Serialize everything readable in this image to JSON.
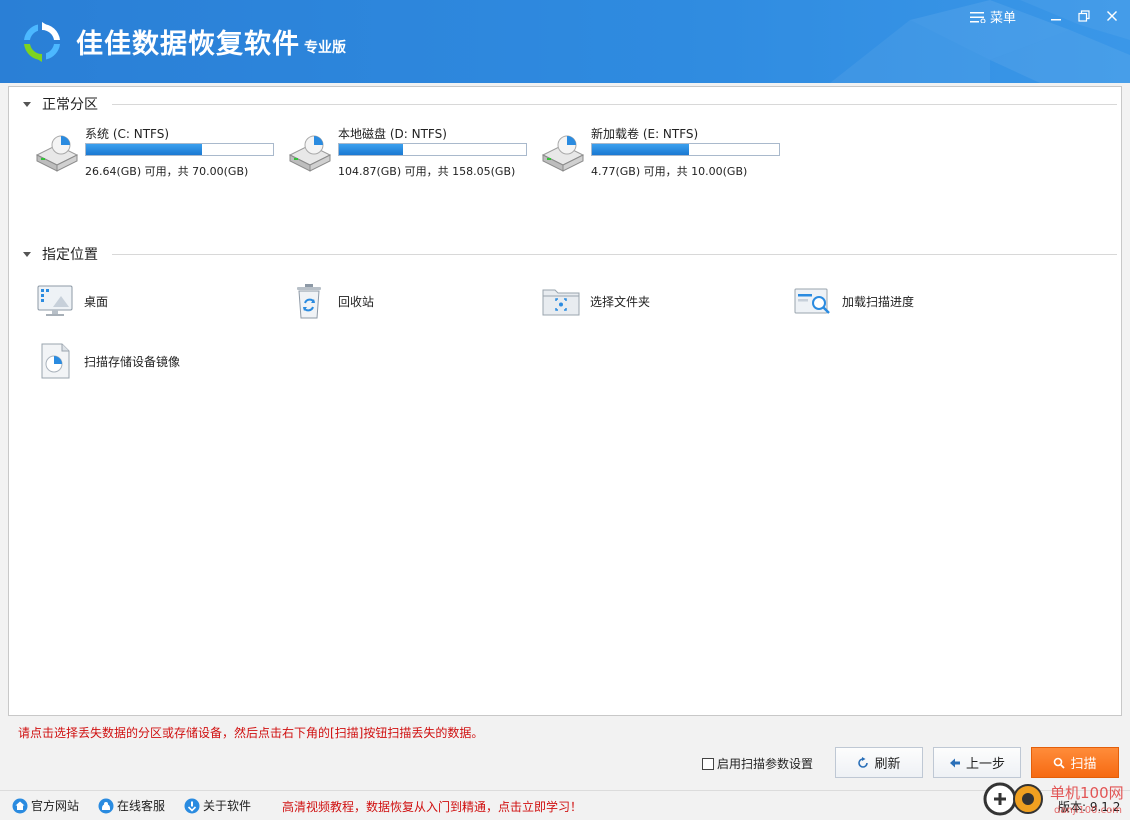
{
  "app": {
    "title": "佳佳数据恢复软件",
    "edition": "专业版",
    "menu_label": "菜单"
  },
  "sections": {
    "partitions_title": "正常分区",
    "locations_title": "指定位置"
  },
  "drives": [
    {
      "name": "系统 (C: NTFS)",
      "info": "26.64(GB) 可用，共 70.00(GB)",
      "used_fraction": 0.62
    },
    {
      "name": "本地磁盘 (D: NTFS)",
      "info": "104.87(GB) 可用，共 158.05(GB)",
      "used_fraction": 0.34
    },
    {
      "name": "新加载卷 (E: NTFS)",
      "info": "4.77(GB) 可用，共 10.00(GB)",
      "used_fraction": 0.52
    }
  ],
  "locations": [
    {
      "name": "桌面",
      "icon": "desktop-icon"
    },
    {
      "name": "回收站",
      "icon": "recycle-bin-icon"
    },
    {
      "name": "选择文件夹",
      "icon": "folder-icon"
    },
    {
      "name": "加载扫描进度",
      "icon": "load-progress-icon"
    },
    {
      "name": "扫描存储设备镜像",
      "icon": "disk-image-icon"
    }
  ],
  "hint": "请点击选择丢失数据的分区或存储设备，然后点击右下角的[扫描]按钮扫描丢失的数据。",
  "controls": {
    "scan_params_label": "启用扫描参数设置",
    "refresh_label": "刷新",
    "back_label": "上一步",
    "scan_label": "扫描"
  },
  "statusbar": {
    "website_label": "官方网站",
    "support_label": "在线客服",
    "about_label": "关于软件",
    "promo": "高清视频教程，数据恢复从入门到精通，点击立即学习！",
    "version": "版本: 9.1.2"
  },
  "watermark": {
    "text": "单机100网",
    "domain": "danji100.com"
  },
  "colors": {
    "titlebar": "#2f8be0",
    "accent_orange": "#f66a12",
    "hint_red": "#d01010",
    "progress_blue": "#1a78d2"
  }
}
